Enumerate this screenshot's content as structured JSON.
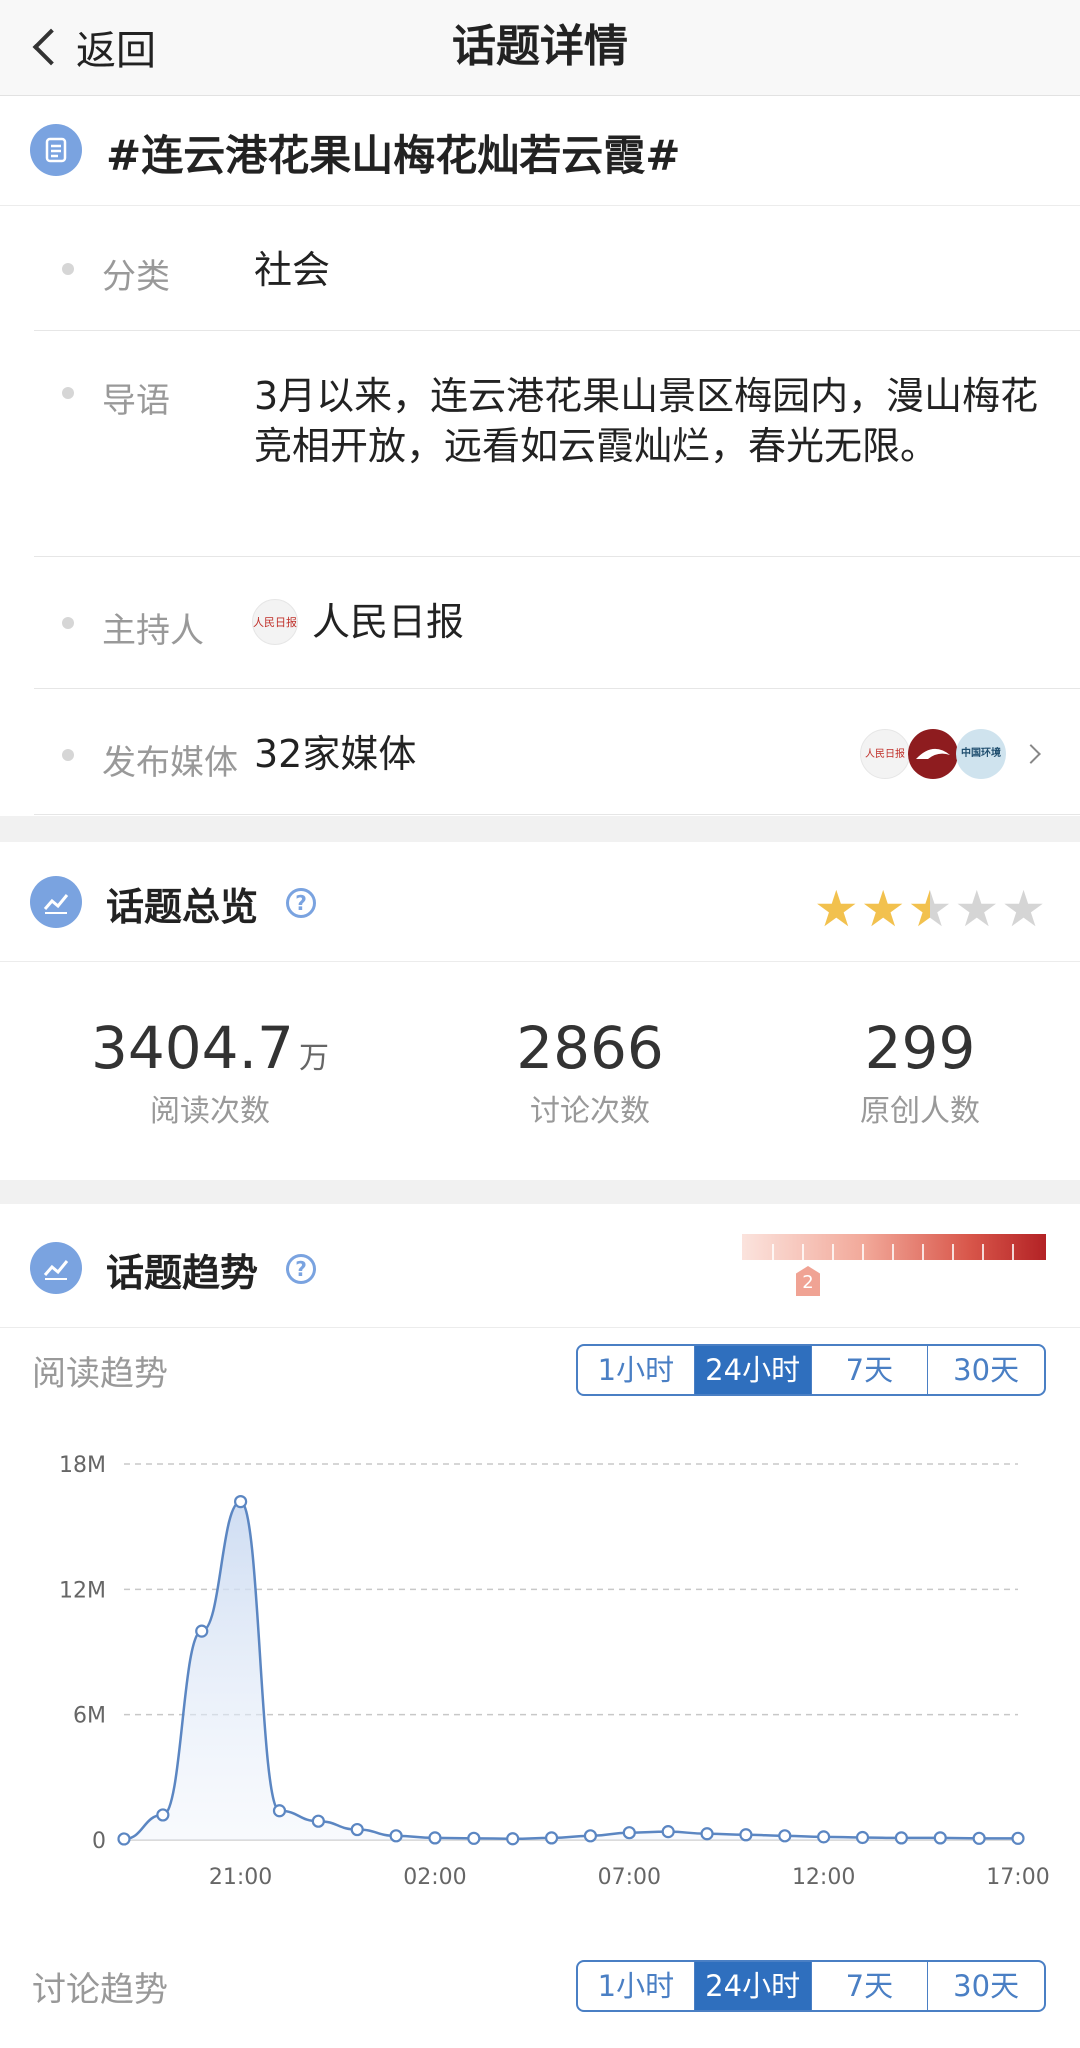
{
  "nav": {
    "back_label": "返回",
    "title": "话题详情"
  },
  "topic": {
    "title": "#连云港花果山梅花灿若云霞#"
  },
  "info": {
    "category": {
      "label": "分类",
      "value": "社会"
    },
    "intro": {
      "label": "导语",
      "value": "3月以来，连云港花果山景区梅园内，漫山梅花竞相开放，远看如云霞灿烂，春光无限。"
    },
    "host": {
      "label": "主持人",
      "value": "人民日报"
    },
    "media": {
      "label": "发布媒体",
      "value": "32家媒体",
      "avatars": [
        "人民日报",
        "",
        "中国环境"
      ]
    }
  },
  "overview": {
    "title": "话题总览",
    "help": "?",
    "rating": 2.5,
    "stats": [
      {
        "value": "3404.7",
        "unit": "万",
        "label": "阅读次数"
      },
      {
        "value": "2866",
        "unit": "",
        "label": "讨论次数"
      },
      {
        "value": "299",
        "unit": "",
        "label": "原创人数"
      }
    ]
  },
  "trend": {
    "title": "话题趋势",
    "help": "?",
    "heat_level": "2",
    "read_label": "阅读趋势",
    "discuss_label": "讨论趋势",
    "ranges": [
      "1小时",
      "24小时",
      "7天",
      "30天"
    ],
    "active_range": "24小时"
  },
  "colors": {
    "accent": "#2f6fbe",
    "icon": "#7aa3e0",
    "line": "#5b86c2",
    "star": "#f2c14e"
  },
  "chart_data": {
    "type": "area",
    "x": [
      "18:00",
      "19:00",
      "20:00",
      "21:00",
      "22:00",
      "23:00",
      "00:00",
      "01:00",
      "02:00",
      "03:00",
      "04:00",
      "05:00",
      "06:00",
      "07:00",
      "08:00",
      "09:00",
      "10:00",
      "11:00",
      "12:00",
      "13:00",
      "14:00",
      "15:00",
      "16:00",
      "17:00"
    ],
    "values": [
      0.05,
      1.2,
      10.0,
      16.2,
      1.4,
      0.9,
      0.5,
      0.2,
      0.1,
      0.08,
      0.06,
      0.1,
      0.2,
      0.35,
      0.4,
      0.3,
      0.25,
      0.2,
      0.15,
      0.12,
      0.1,
      0.1,
      0.08,
      0.08
    ],
    "value_unit": "M",
    "ylim": [
      0,
      18
    ],
    "yticks": [
      "0",
      "6M",
      "12M",
      "18M"
    ],
    "xticks": [
      "21:00",
      "02:00",
      "07:00",
      "12:00",
      "17:00"
    ],
    "grid": true
  }
}
